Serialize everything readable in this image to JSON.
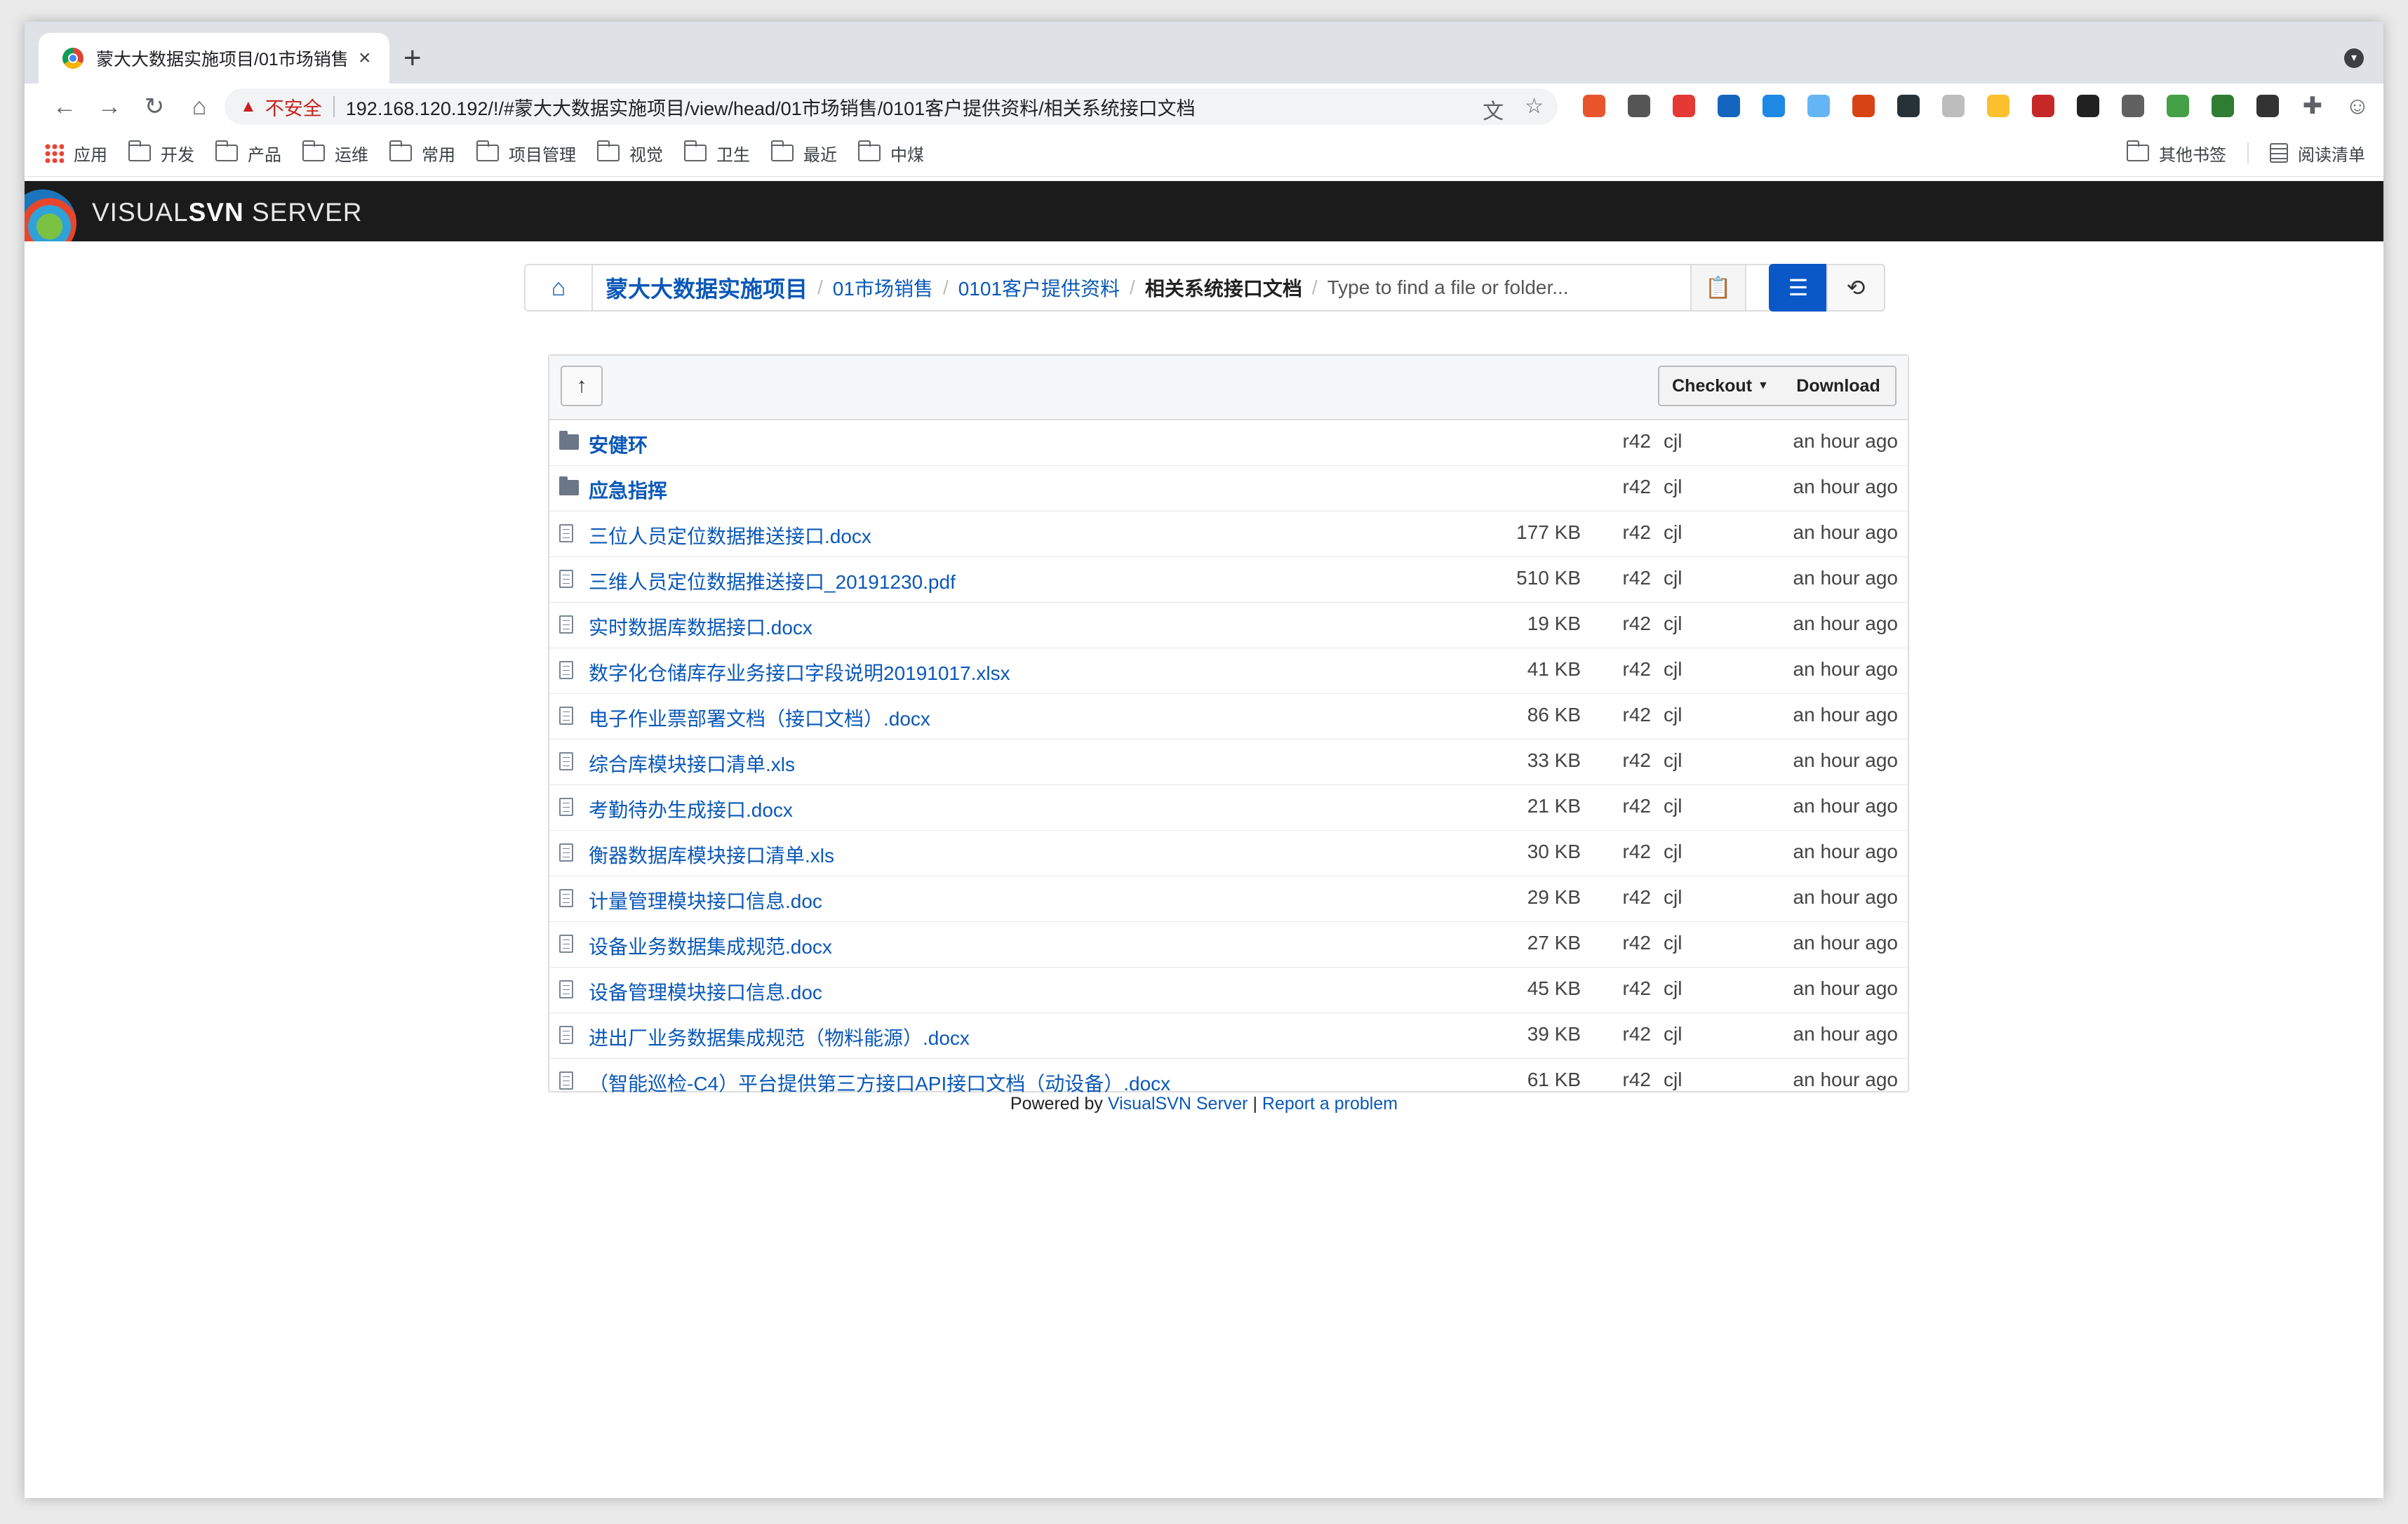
{
  "browser": {
    "tab_title": "蒙大大数据实施项目/01市场销售",
    "tab_close": "×",
    "new_tab": "+",
    "security_warning": "不安全",
    "url": "192.168.120.192/!/#蒙大大数据实施项目/view/head/01市场销售/0101客户提供资料/相关系统接口文档",
    "bookmarks": [
      "应用",
      "开发",
      "产品",
      "运维",
      "常用",
      "项目管理",
      "视觉",
      "卫生",
      "最近",
      "中煤"
    ],
    "bookmarks_right": [
      "其他书签",
      "阅读清单"
    ],
    "extension_colors": [
      "#e8552d",
      "#555555",
      "#e53935",
      "#1565c0",
      "#1e88e5",
      "#64b5f6",
      "#d84315",
      "#263238",
      "#bdbdbd",
      "#fbc02d",
      "#c62828",
      "#212121",
      "#616161",
      "#43a047",
      "#2e7d32",
      "#333333"
    ]
  },
  "app": {
    "brand_light": "VISUAL",
    "brand_bold": "SVN",
    "brand_suffix": " SERVER"
  },
  "breadcrumb": {
    "items": [
      "蒙大大数据实施项目",
      "01市场销售",
      "0101客户提供资料"
    ],
    "current": "相关系统接口文档",
    "search_placeholder": "Type to find a file or folder..."
  },
  "toolbar": {
    "up_label": "↑",
    "checkout_label": "Checkout",
    "download_label": "Download"
  },
  "files": [
    {
      "type": "dir",
      "name": "安健环",
      "size": "",
      "rev": "r42",
      "author": "cjl",
      "time": "an hour ago"
    },
    {
      "type": "dir",
      "name": "应急指挥",
      "size": "",
      "rev": "r42",
      "author": "cjl",
      "time": "an hour ago"
    },
    {
      "type": "file",
      "name": "三位人员定位数据推送接口.docx",
      "size": "177 KB",
      "rev": "r42",
      "author": "cjl",
      "time": "an hour ago"
    },
    {
      "type": "file",
      "name": "三维人员定位数据推送接口_20191230.pdf",
      "size": "510 KB",
      "rev": "r42",
      "author": "cjl",
      "time": "an hour ago"
    },
    {
      "type": "file",
      "name": "实时数据库数据接口.docx",
      "size": "19 KB",
      "rev": "r42",
      "author": "cjl",
      "time": "an hour ago"
    },
    {
      "type": "file",
      "name": "数字化仓储库存业务接口字段说明20191017.xlsx",
      "size": "41 KB",
      "rev": "r42",
      "author": "cjl",
      "time": "an hour ago"
    },
    {
      "type": "file",
      "name": "电子作业票部署文档（接口文档）.docx",
      "size": "86 KB",
      "rev": "r42",
      "author": "cjl",
      "time": "an hour ago"
    },
    {
      "type": "file",
      "name": "综合库模块接口清单.xls",
      "size": "33 KB",
      "rev": "r42",
      "author": "cjl",
      "time": "an hour ago"
    },
    {
      "type": "file",
      "name": "考勤待办生成接口.docx",
      "size": "21 KB",
      "rev": "r42",
      "author": "cjl",
      "time": "an hour ago"
    },
    {
      "type": "file",
      "name": "衡器数据库模块接口清单.xls",
      "size": "30 KB",
      "rev": "r42",
      "author": "cjl",
      "time": "an hour ago"
    },
    {
      "type": "file",
      "name": "计量管理模块接口信息.doc",
      "size": "29 KB",
      "rev": "r42",
      "author": "cjl",
      "time": "an hour ago"
    },
    {
      "type": "file",
      "name": "设备业务数据集成规范.docx",
      "size": "27 KB",
      "rev": "r42",
      "author": "cjl",
      "time": "an hour ago"
    },
    {
      "type": "file",
      "name": "设备管理模块接口信息.doc",
      "size": "45 KB",
      "rev": "r42",
      "author": "cjl",
      "time": "an hour ago"
    },
    {
      "type": "file",
      "name": "进出厂业务数据集成规范（物料能源）.docx",
      "size": "39 KB",
      "rev": "r42",
      "author": "cjl",
      "time": "an hour ago"
    },
    {
      "type": "file",
      "name": "（智能巡检-C4）平台提供第三方接口API接口文档（动设备）.docx",
      "size": "61 KB",
      "rev": "r42",
      "author": "cjl",
      "time": "an hour ago"
    }
  ],
  "footer": {
    "powered_by": "Powered by",
    "product_link": "VisualSVN Server",
    "separator": "|",
    "report_link": "Report a problem"
  }
}
